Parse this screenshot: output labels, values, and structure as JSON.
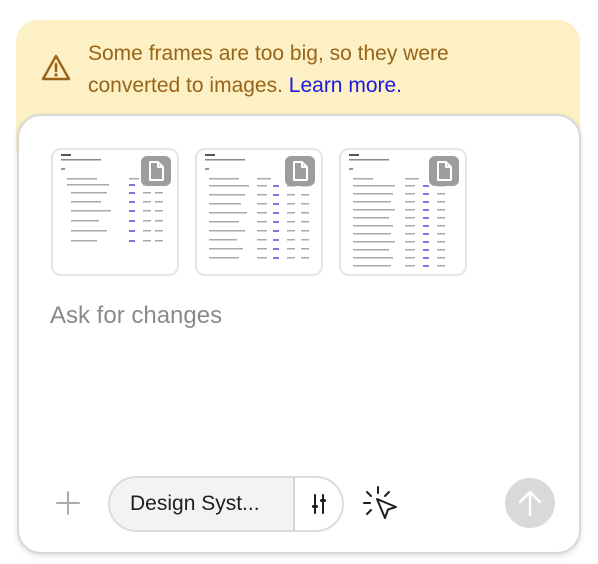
{
  "warning": {
    "message": "Some frames are too big, so they were converted to images.",
    "link_label": "Learn more.",
    "icon": "warning-triangle-icon"
  },
  "attachments": [
    {
      "label": "frame-image-1",
      "icon": "file-icon"
    },
    {
      "label": "frame-image-2",
      "icon": "file-icon"
    },
    {
      "label": "frame-image-3",
      "icon": "file-icon"
    }
  ],
  "prompt": {
    "placeholder": "Ask for changes",
    "value": ""
  },
  "toolbar": {
    "add_icon": "plus-icon",
    "design_system_label": "Design Syst...",
    "settings_icon": "sliders-icon",
    "pointer_icon": "cursor-click-icon",
    "send_icon": "arrow-up-icon"
  },
  "colors": {
    "warning_bg": "#fcf0c4",
    "warning_text": "#9a6418",
    "link": "#1a1ae0",
    "send_disabled": "#d9d9d9"
  }
}
